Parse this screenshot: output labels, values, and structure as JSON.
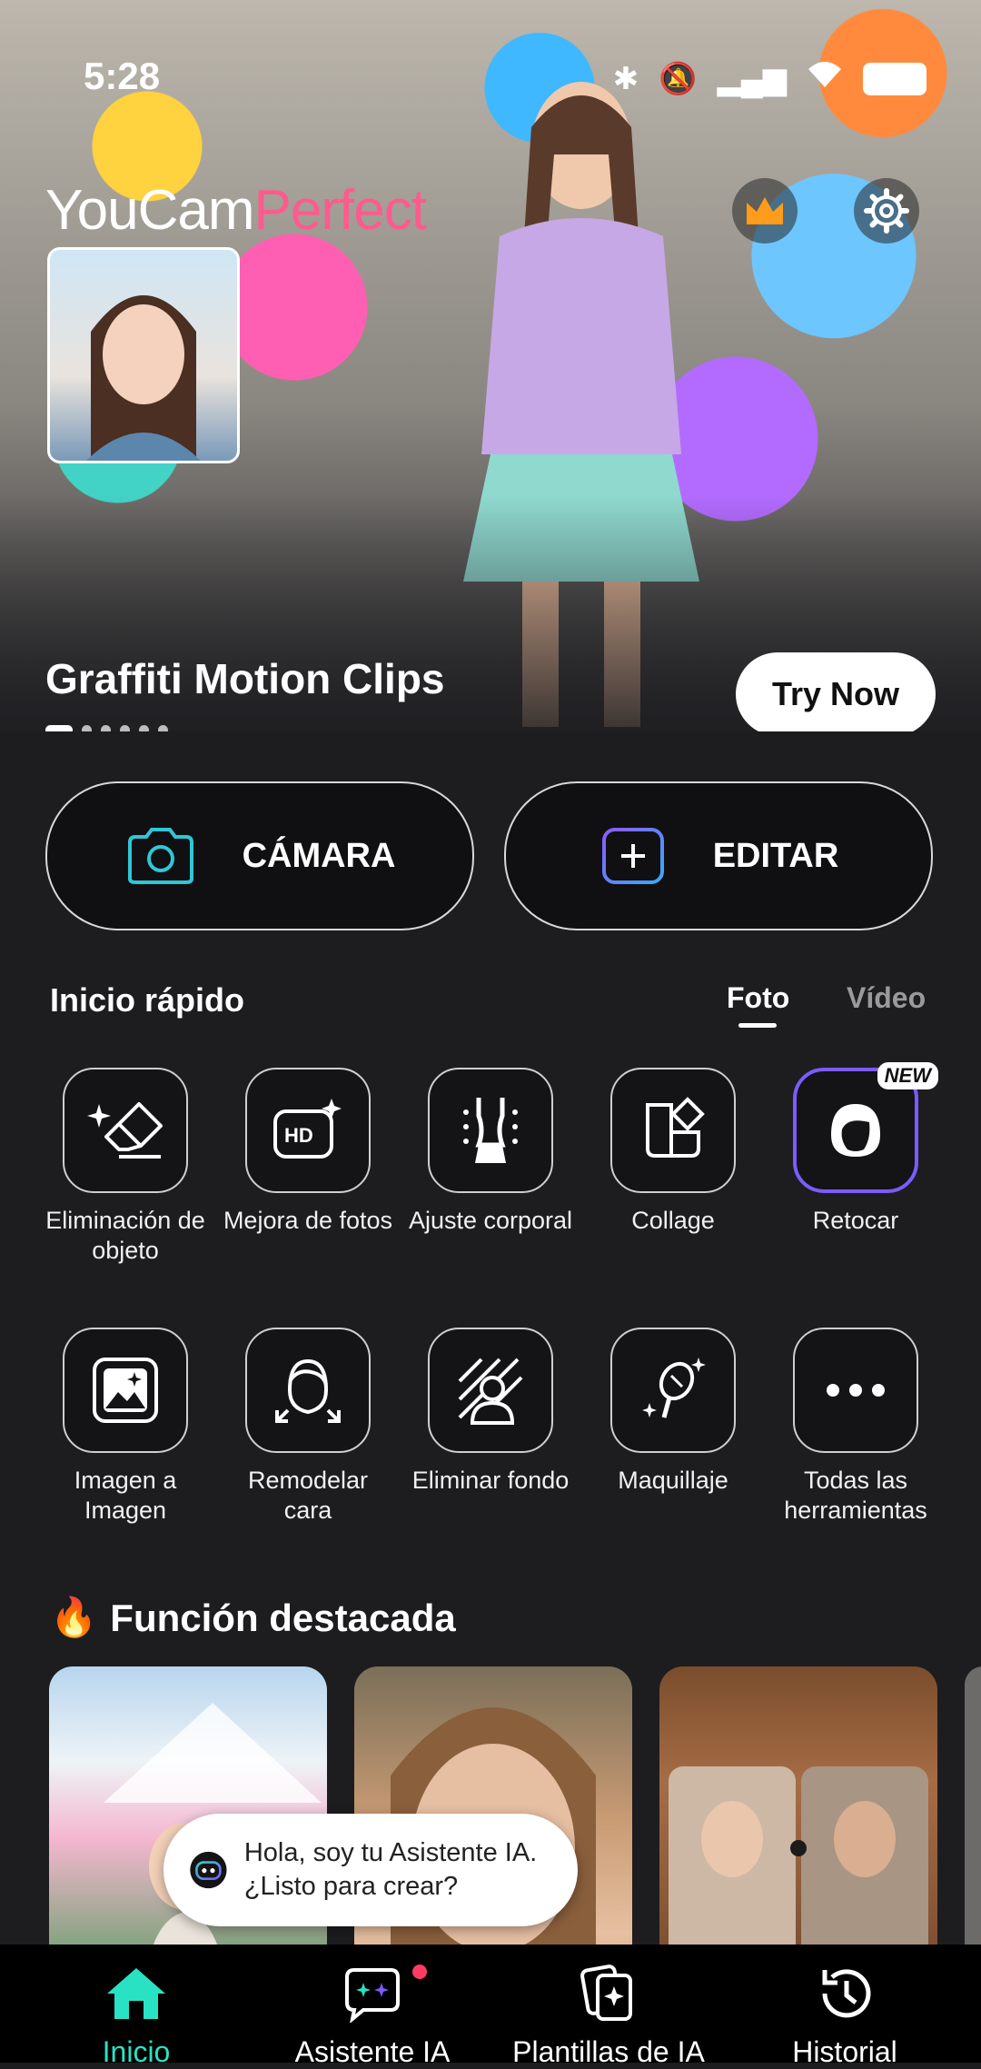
{
  "status_bar": {
    "time": "5:28"
  },
  "hero": {
    "brand_part1": "YouCam",
    "brand_part2": "Perfect",
    "title": "Graffiti Motion Clips",
    "cta": "Try Now",
    "slides_total": 6,
    "slide_active": 1
  },
  "actions": {
    "camera": "CÁMARA",
    "edit": "EDITAR"
  },
  "quick_start": {
    "title": "Inicio rápido",
    "tabs": [
      "Foto",
      "Vídeo"
    ],
    "active_tab": "Foto",
    "badge_new": "NEW",
    "tools": [
      {
        "label": "Eliminación de objeto",
        "icon": "magic-eraser-icon"
      },
      {
        "label": "Mejora de fotos",
        "icon": "hd-enhance-icon"
      },
      {
        "label": "Ajuste corporal",
        "icon": "body-shape-icon"
      },
      {
        "label": "Collage",
        "icon": "collage-icon"
      },
      {
        "label": "Retocar",
        "icon": "face-retouch-icon"
      },
      {
        "label": "Imagen a Imagen",
        "icon": "image-to-image-icon"
      },
      {
        "label": "Remodelar cara",
        "icon": "face-reshape-icon"
      },
      {
        "label": "Eliminar fondo",
        "icon": "remove-background-icon"
      },
      {
        "label": "Maquillaje",
        "icon": "makeup-icon"
      },
      {
        "label": "Todas las herramientas",
        "icon": "more-icon"
      }
    ]
  },
  "featured": {
    "title": "Función destacada",
    "emoji": "🔥"
  },
  "assistant": {
    "message": "Hola, soy tu Asistente IA. ¿Listo para crear?"
  },
  "bottom_nav": {
    "items": [
      {
        "label": "Inicio",
        "icon": "home-icon",
        "active": true
      },
      {
        "label": "Asistente IA",
        "icon": "ai-assistant-icon",
        "active": false
      },
      {
        "label": "Plantillas de IA",
        "icon": "ai-templates-icon",
        "active": false
      },
      {
        "label": "Historial",
        "icon": "history-icon",
        "active": false
      }
    ]
  },
  "colors": {
    "background": "#1d1d20",
    "accent_teal": "#29e2c3",
    "brand_pink": "#ff5a8e",
    "edit_purple": "#7b5cff",
    "notification_red": "#ff3b63"
  }
}
